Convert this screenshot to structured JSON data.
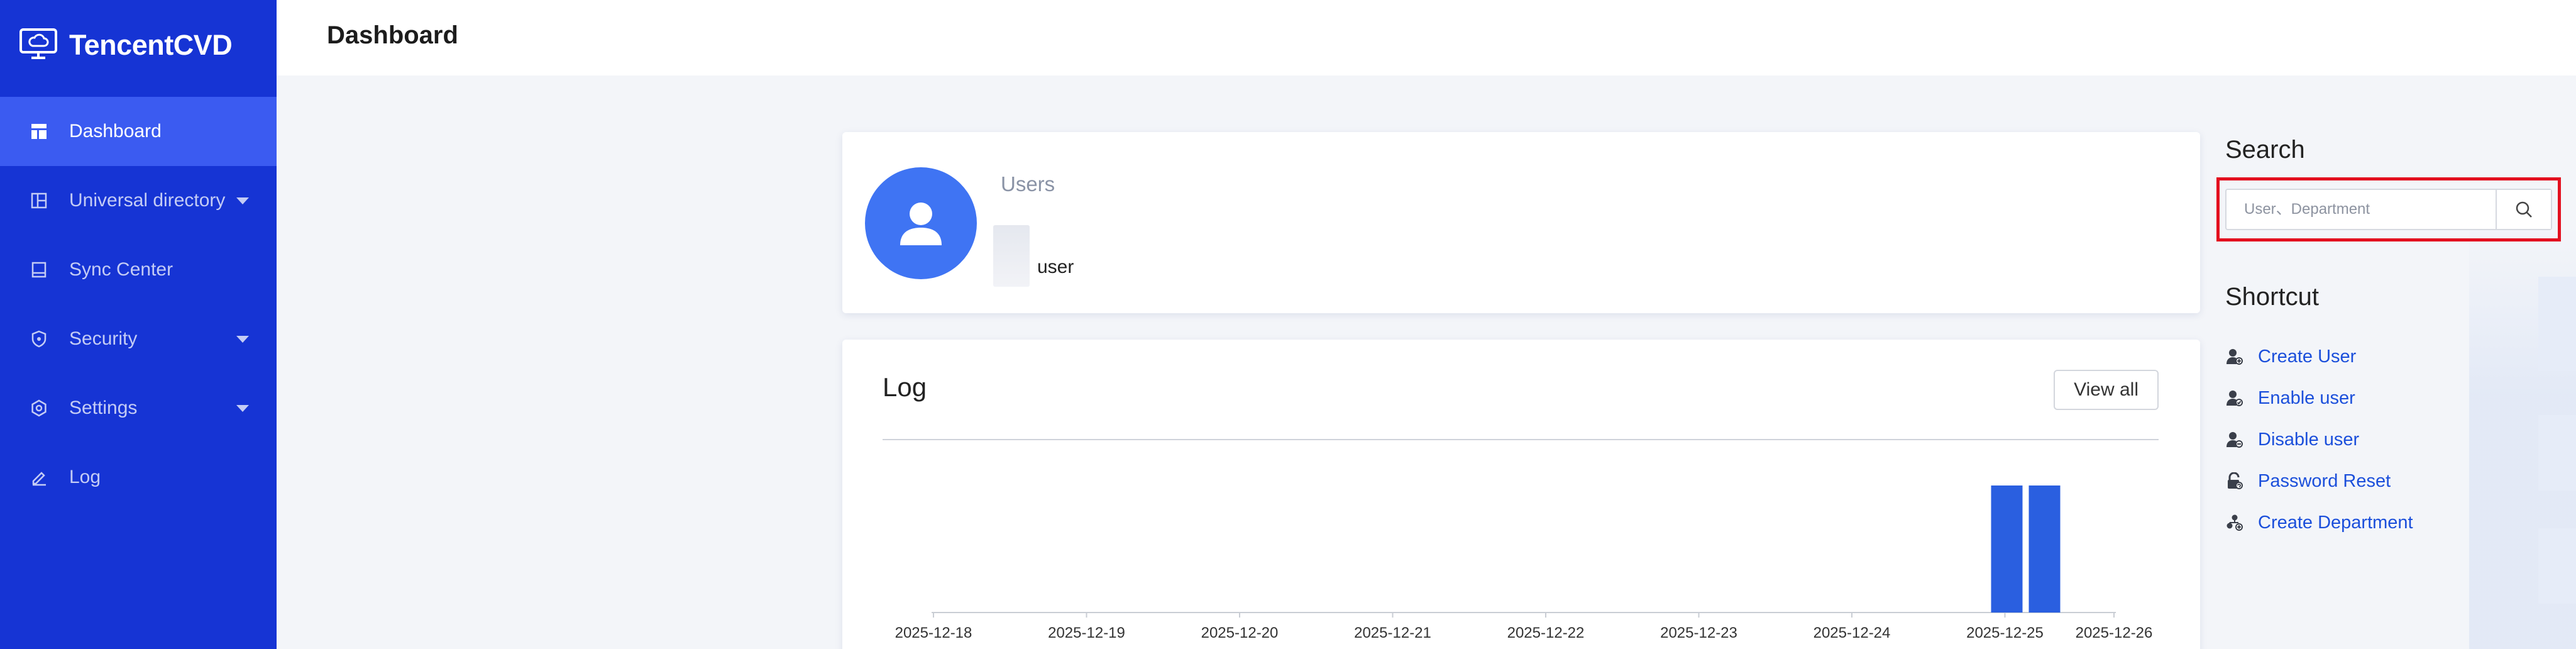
{
  "app": {
    "name": "TencentCVD"
  },
  "sidebar": {
    "items": [
      {
        "label": "Dashboard",
        "icon": "dashboard-icon",
        "active": true,
        "has_submenu": false
      },
      {
        "label": "Universal directory",
        "icon": "directory-icon",
        "active": false,
        "has_submenu": true
      },
      {
        "label": "Sync Center",
        "icon": "sync-icon",
        "active": false,
        "has_submenu": false
      },
      {
        "label": "Security",
        "icon": "shield-icon",
        "active": false,
        "has_submenu": true
      },
      {
        "label": "Settings",
        "icon": "gear-icon",
        "active": false,
        "has_submenu": true
      },
      {
        "label": "Log",
        "icon": "edit-icon",
        "active": false,
        "has_submenu": false
      }
    ]
  },
  "header": {
    "title": "Dashboard"
  },
  "users_card": {
    "title": "Users",
    "unit": "user"
  },
  "log_card": {
    "title": "Log",
    "view_all_label": "View all"
  },
  "search": {
    "title": "Search",
    "placeholder": "User、Department",
    "value": ""
  },
  "shortcut": {
    "title": "Shortcut",
    "items": [
      {
        "label": "Create User",
        "icon": "user-add-icon"
      },
      {
        "label": "Enable user",
        "icon": "user-enable-icon"
      },
      {
        "label": "Disable user",
        "icon": "user-disable-icon"
      },
      {
        "label": "Password Reset",
        "icon": "lock-reset-icon"
      },
      {
        "label": "Create Department",
        "icon": "department-icon"
      }
    ]
  },
  "colors": {
    "sidebar_bg": "#1634d4",
    "sidebar_active": "#3b5bf1",
    "accent": "#3f74f3",
    "link": "#1b4fdb",
    "bar": "#2a5fe0",
    "highlight": "#e3101f"
  },
  "chart_data": {
    "type": "bar",
    "categories": [
      "2025-12-18",
      "2025-12-19",
      "2025-12-20",
      "2025-12-21",
      "2025-12-22",
      "2025-12-23",
      "2025-12-24",
      "2025-12-25",
      "2025-12-26"
    ],
    "series": [
      {
        "values": [
          0,
          0,
          0,
          0,
          0,
          0,
          0,
          1,
          0
        ]
      },
      {
        "values": [
          0,
          0,
          0,
          0,
          0,
          0,
          0,
          1,
          0
        ]
      }
    ],
    "title": "",
    "xlabel": "",
    "ylabel": "",
    "grid": false
  }
}
